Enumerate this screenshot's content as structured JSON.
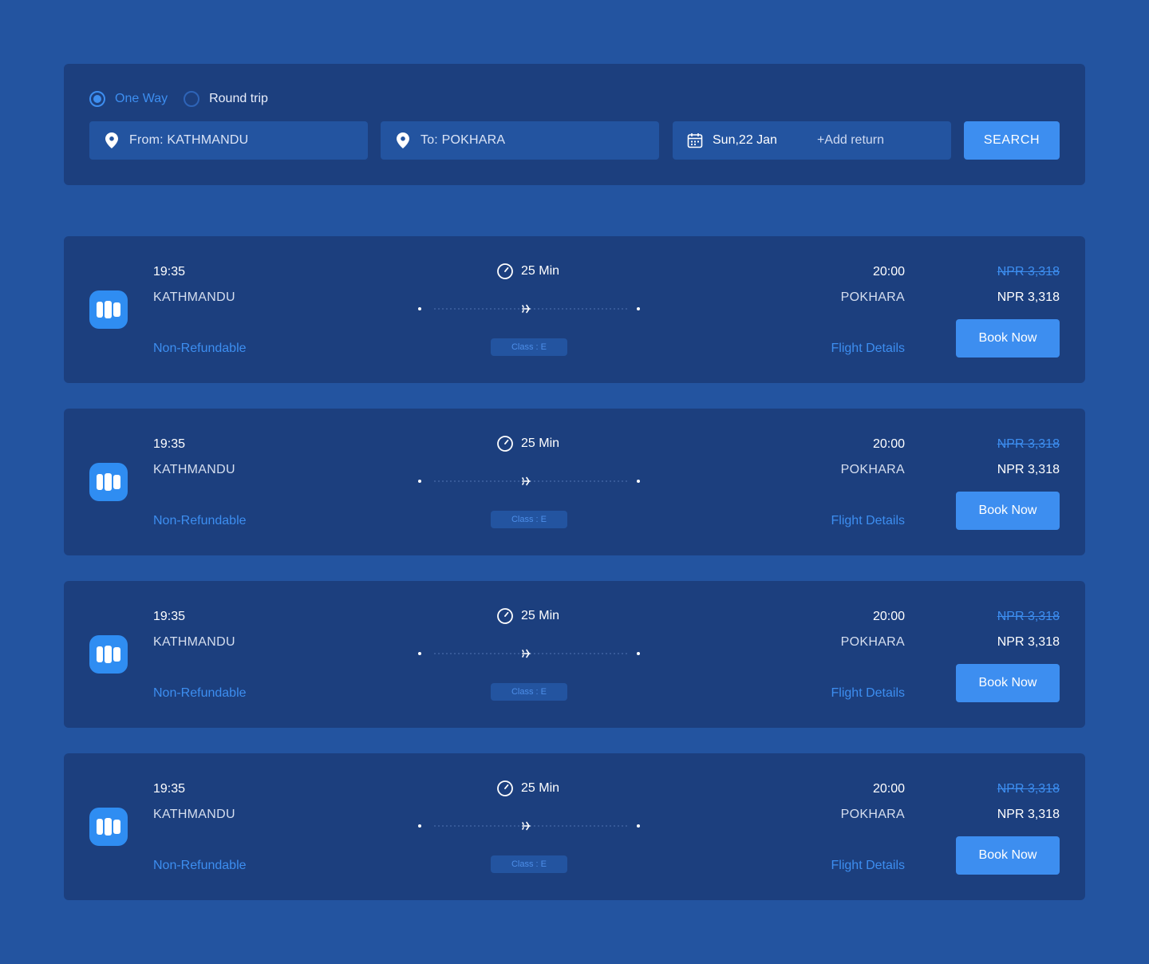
{
  "search": {
    "trip_types": [
      {
        "label": "One Way",
        "selected": true
      },
      {
        "label": "Round trip",
        "selected": false
      }
    ],
    "from": "From: KATHMANDU",
    "to": "To: POKHARA",
    "date": "Sun,22 Jan",
    "add_return": "+Add return",
    "search_button": "SEARCH"
  },
  "flights": [
    {
      "departure_time": "19:35",
      "departure_city": "KATHMANDU",
      "refund_policy": "Non-Refundable",
      "duration": "25 Min",
      "class": "Class : E",
      "arrival_time": "20:00",
      "arrival_city": "POKHARA",
      "details_link": "Flight Details",
      "original_price": "NPR 3,318",
      "price": "NPR 3,318",
      "book_button": "Book Now"
    },
    {
      "departure_time": "19:35",
      "departure_city": "KATHMANDU",
      "refund_policy": "Non-Refundable",
      "duration": "25 Min",
      "class": "Class : E",
      "arrival_time": "20:00",
      "arrival_city": "POKHARA",
      "details_link": "Flight Details",
      "original_price": "NPR 3,318",
      "price": "NPR 3,318",
      "book_button": "Book Now"
    },
    {
      "departure_time": "19:35",
      "departure_city": "KATHMANDU",
      "refund_policy": "Non-Refundable",
      "duration": "25 Min",
      "class": "Class : E",
      "arrival_time": "20:00",
      "arrival_city": "POKHARA",
      "details_link": "Flight Details",
      "original_price": "NPR 3,318",
      "price": "NPR 3,318",
      "book_button": "Book Now"
    },
    {
      "departure_time": "19:35",
      "departure_city": "KATHMANDU",
      "refund_policy": "Non-Refundable",
      "duration": "25 Min",
      "class": "Class : E",
      "arrival_time": "20:00",
      "arrival_city": "POKHARA",
      "details_link": "Flight Details",
      "original_price": "NPR 3,318",
      "price": "NPR 3,318",
      "book_button": "Book Now"
    }
  ],
  "icons": {
    "location": "location-pin-icon",
    "calendar": "calendar-icon",
    "clock": "clock-icon",
    "plane": "airplane-icon",
    "airline": "airline-logo"
  },
  "colors": {
    "background": "#2354a0",
    "panel": "#1c3f7e",
    "accent": "#3d8ef0",
    "text": "#ffffff"
  }
}
